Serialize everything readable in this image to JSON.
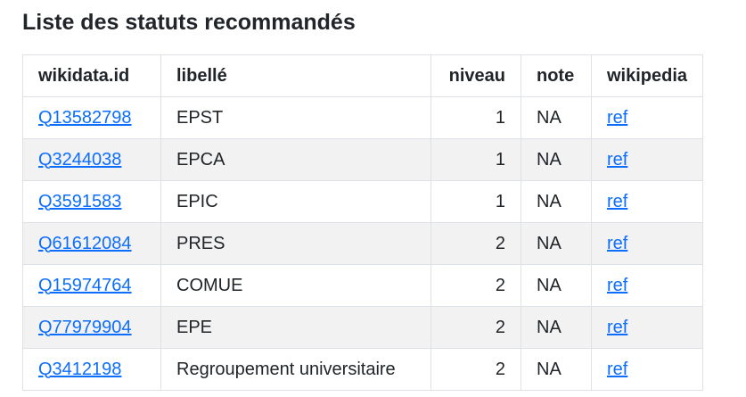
{
  "page": {
    "title": "Liste des statuts recommandés"
  },
  "table": {
    "headers": [
      "wikidata.id",
      "libellé",
      "niveau",
      "note",
      "wikipedia"
    ],
    "rows": [
      {
        "id": "Q13582798",
        "label": "EPST",
        "niveau": "1",
        "note": "NA",
        "wiki": "ref"
      },
      {
        "id": "Q3244038",
        "label": "EPCA",
        "niveau": "1",
        "note": "NA",
        "wiki": "ref"
      },
      {
        "id": "Q3591583",
        "label": "EPIC",
        "niveau": "1",
        "note": "NA",
        "wiki": "ref"
      },
      {
        "id": "Q61612084",
        "label": "PRES",
        "niveau": "2",
        "note": "NA",
        "wiki": "ref"
      },
      {
        "id": "Q15974764",
        "label": "COMUE",
        "niveau": "2",
        "note": "NA",
        "wiki": "ref"
      },
      {
        "id": "Q77979904",
        "label": "EPE",
        "niveau": "2",
        "note": "NA",
        "wiki": "ref"
      },
      {
        "id": "Q3412198",
        "label": "Regroupement universitaire",
        "niveau": "2",
        "note": "NA",
        "wiki": "ref"
      }
    ]
  },
  "colors": {
    "link": "#0d6efd",
    "stripe": "#f2f2f2",
    "border": "#dee2e6",
    "text": "#212529"
  }
}
